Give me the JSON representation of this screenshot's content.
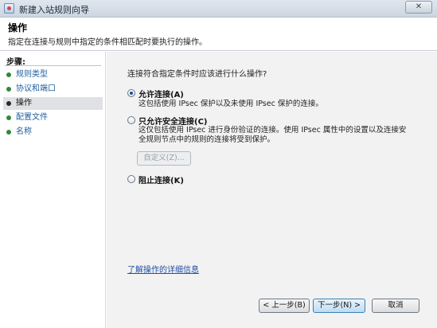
{
  "window": {
    "title": "新建入站规则向导",
    "close_label": "✕"
  },
  "header": {
    "title": "操作",
    "description": "指定在连接与规则中指定的条件相匹配时要执行的操作。"
  },
  "sidebar": {
    "steps_title": "步骤:",
    "items": [
      {
        "label": "规则类型",
        "state": "done"
      },
      {
        "label": "协议和端口",
        "state": "done"
      },
      {
        "label": "操作",
        "state": "current"
      },
      {
        "label": "配置文件",
        "state": "done"
      },
      {
        "label": "名称",
        "state": "done"
      }
    ]
  },
  "main": {
    "question": "连接符合指定条件时应该进行什么操作?",
    "options": [
      {
        "label": "允许连接(A)",
        "checked": true,
        "description": [
          "这包括使用 IPsec 保护以及未使用 IPsec 保护的连接。"
        ]
      },
      {
        "label": "只允许安全连接(C)",
        "checked": false,
        "description": [
          "这仅包括使用 IPsec 进行身份验证的连接。使用 IPsec 属性中的设置以及连接安",
          "全规则节点中的规则的连接将受到保护。"
        ]
      },
      {
        "label": "阻止连接(K)",
        "checked": false,
        "description": []
      }
    ],
    "custom_button": "自定义(Z)...",
    "learn_more": "了解操作的详细信息"
  },
  "buttons": {
    "back": "< 上一步(B)",
    "next": "下一步(N) >",
    "cancel": "取消"
  },
  "colors": {
    "link": "#1f4fa8",
    "step_done_bullet": "#2f8a3a",
    "panel_bg": "#f2f2f2"
  }
}
